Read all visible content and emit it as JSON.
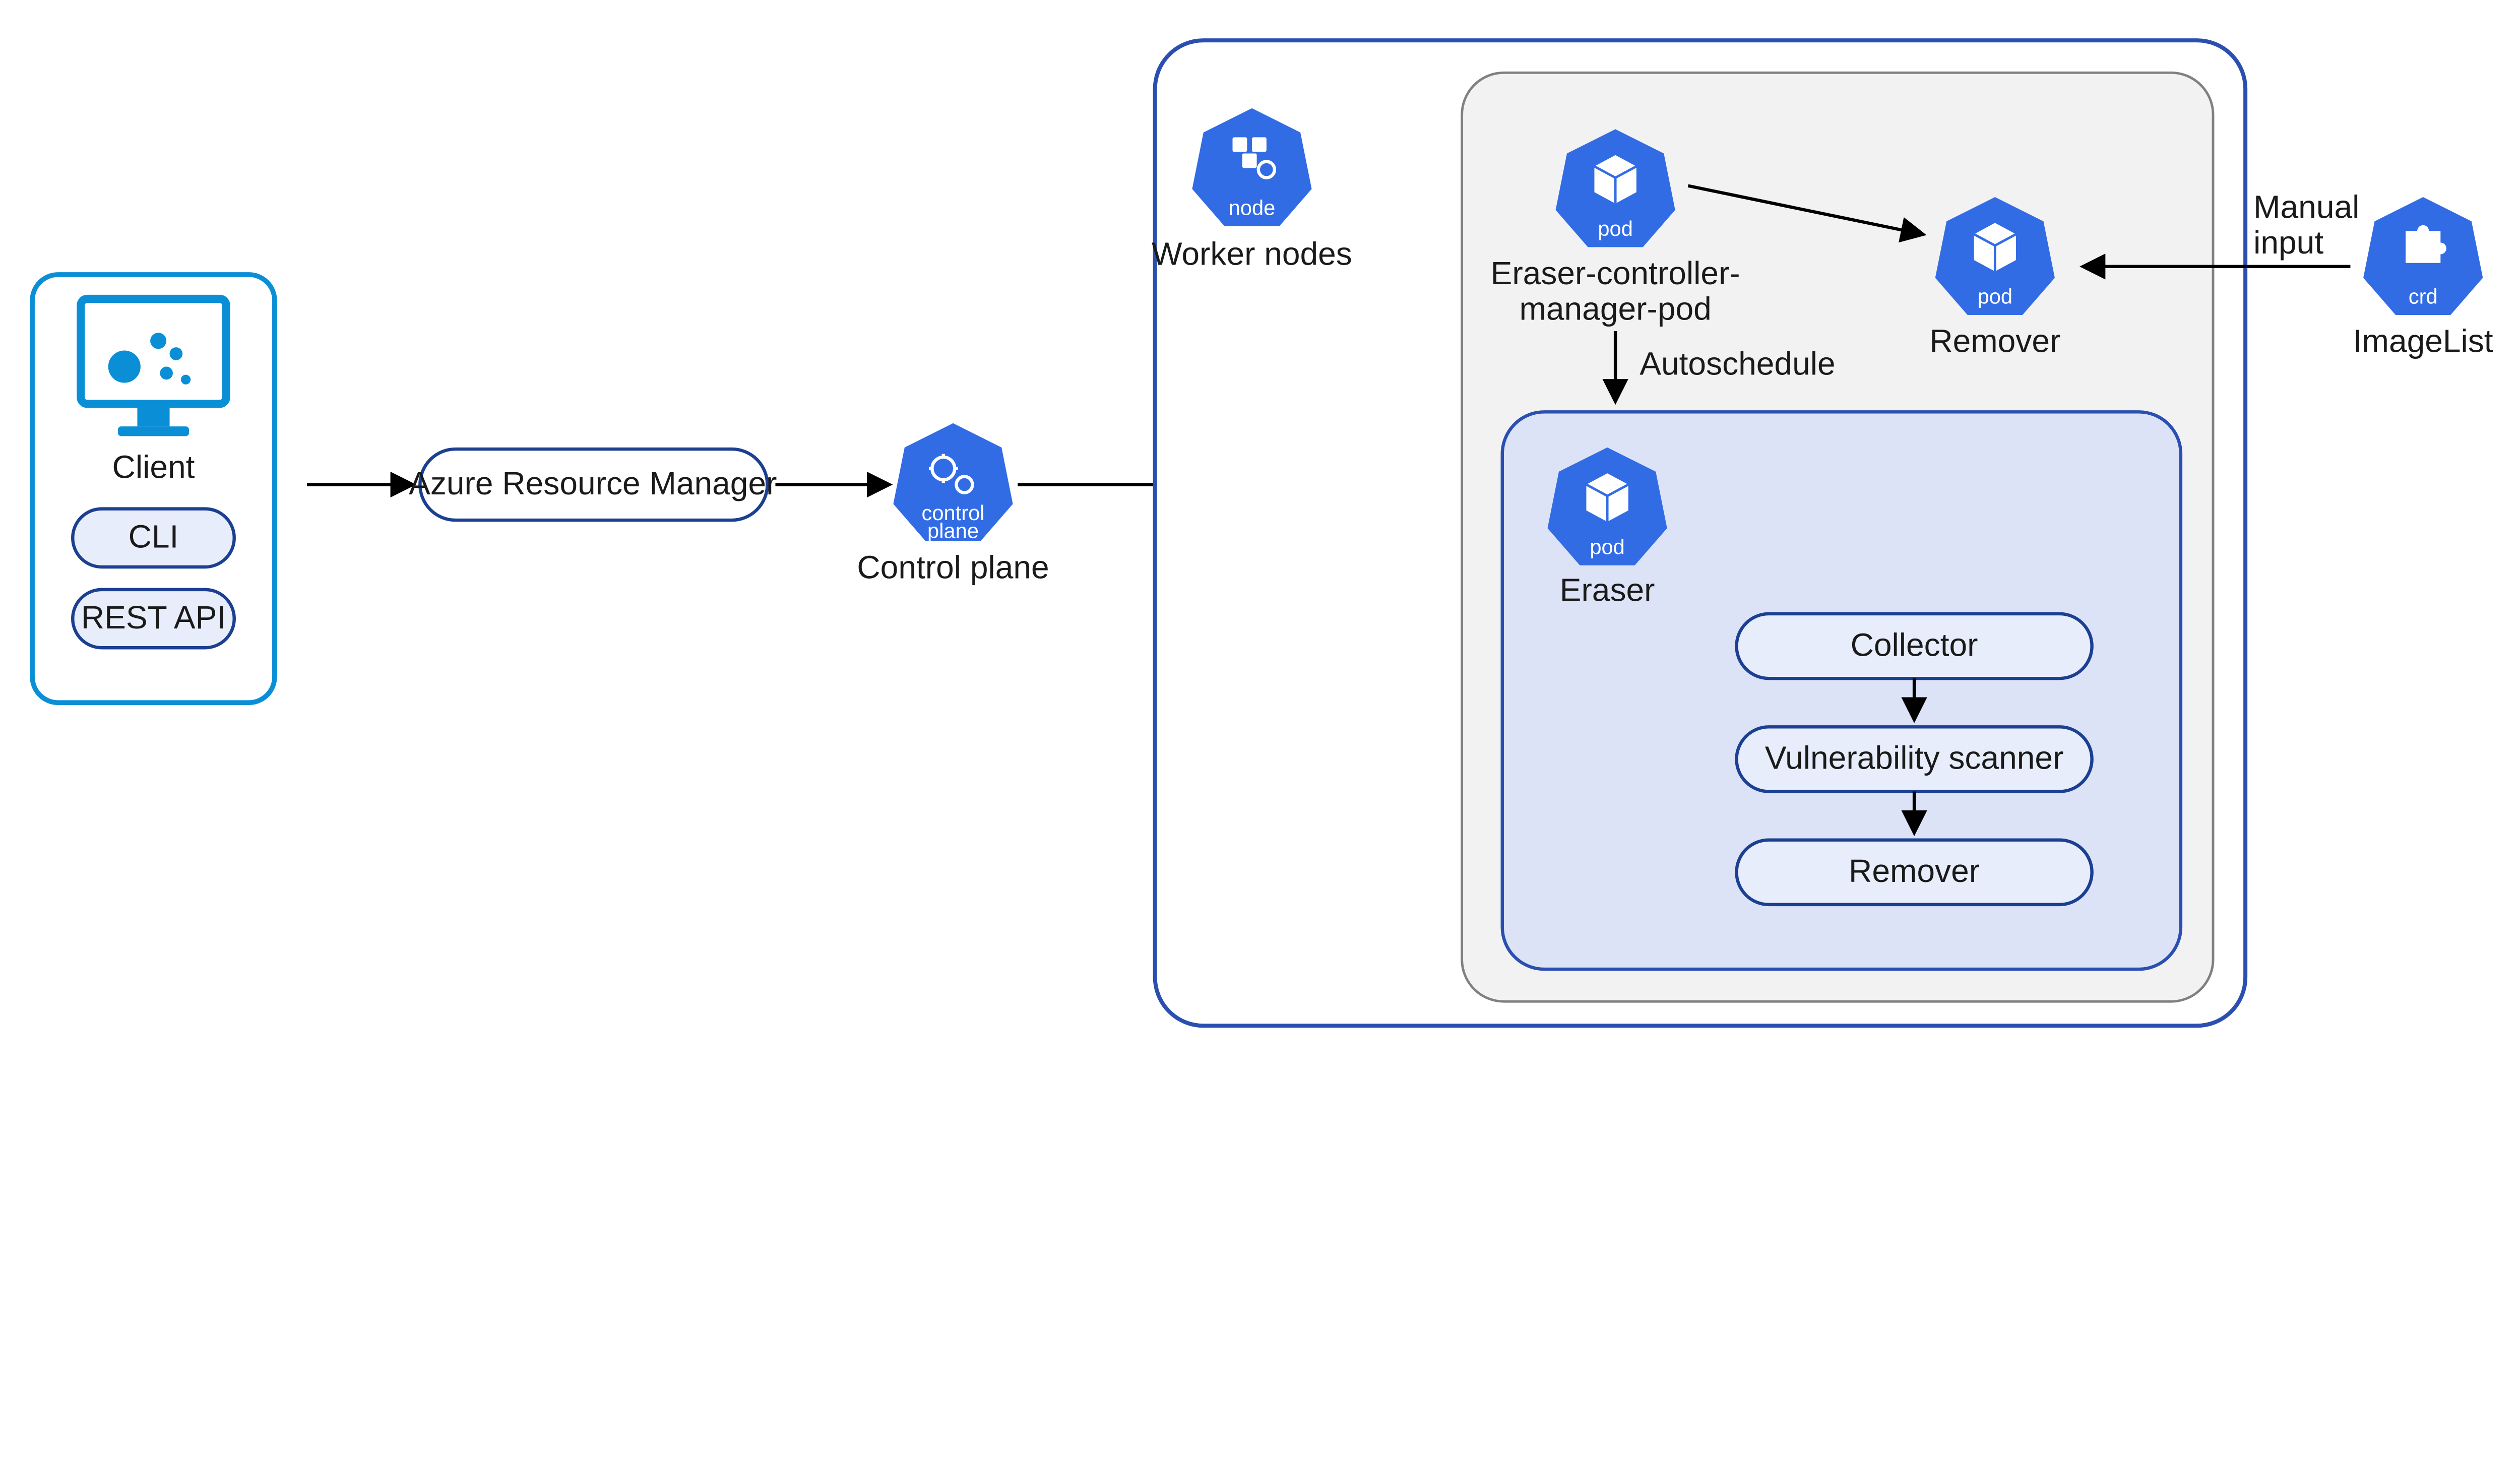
{
  "client": {
    "title": "Client",
    "cli": "CLI",
    "rest_api": "REST API"
  },
  "arm": {
    "label": "Azure Resource Manager"
  },
  "control_plane": {
    "label": "Control plane",
    "icon_label": "control\nplane"
  },
  "worker_nodes": {
    "label": "Worker nodes",
    "icon_label": "node"
  },
  "manager_pod": {
    "label_line1": "Eraser-controller-",
    "label_line2": "manager-pod",
    "icon_label": "pod"
  },
  "remover_pod": {
    "label": "Remover",
    "icon_label": "pod"
  },
  "autoschedule": {
    "label": "Autoschedule"
  },
  "eraser_pod": {
    "label": "Eraser",
    "icon_label": "pod"
  },
  "stages": {
    "collector": "Collector",
    "scanner": "Vulnerability scanner",
    "remover": "Remover"
  },
  "manual_input": {
    "line1": "Manual",
    "line2": "input"
  },
  "imagelist": {
    "label": "ImageList",
    "icon_label": "crd"
  },
  "colors": {
    "k8s_blue": "#326ce5",
    "azure_blue": "#0a8fd6",
    "dark_blue": "#1b3f91"
  }
}
